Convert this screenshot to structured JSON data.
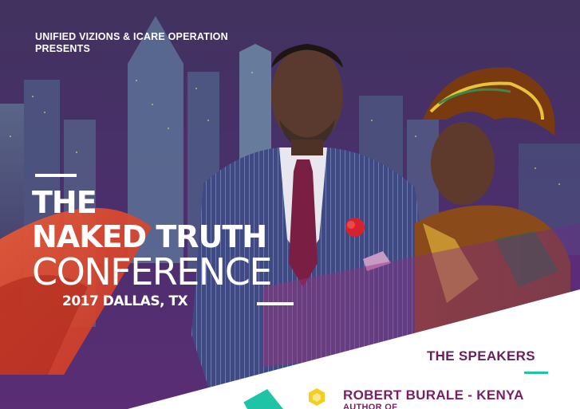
{
  "presenter": {
    "line1": "UNIFIED VIZIONS & ICARE OPERATION",
    "line2": "PRESENTS"
  },
  "event": {
    "title_line1": "THE",
    "title_line2": "NAKED TRUTH",
    "title_line3": "CONFERENCE",
    "subtitle": "2017 DALLAS, TX"
  },
  "speakers": {
    "heading": "THE SPEAKERS",
    "items": [
      {
        "name": "ROBERT BURALE - KENYA",
        "role": "AUTHOR OF"
      }
    ]
  },
  "colors": {
    "accent_red": "#e0432e",
    "accent_teal": "#1fc4a6",
    "accent_yellow": "#f2cf1f",
    "accent_purple": "#7a1f62"
  }
}
